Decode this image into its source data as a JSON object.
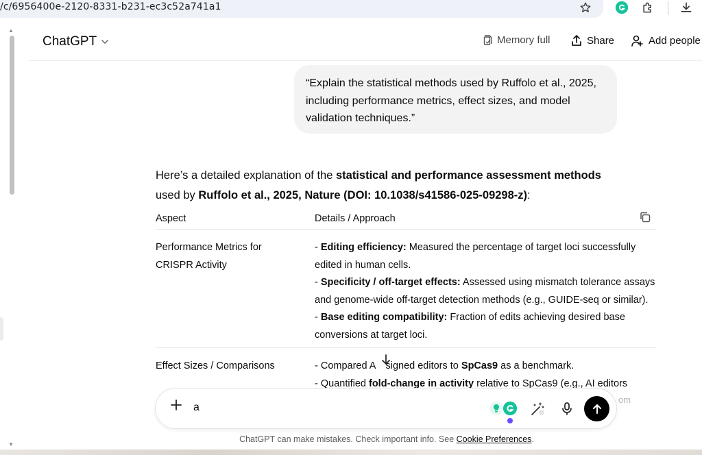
{
  "browser": {
    "url": "/c/6956400e-2120-8331-b231-ec3c52a741a1",
    "icons": [
      "star-icon",
      "grammarly-icon",
      "extensions-icon",
      "download-icon"
    ]
  },
  "header": {
    "model_name": "ChatGPT",
    "memory_label": "Memory full",
    "share_label": "Share",
    "add_people_label": "Add people"
  },
  "user_message": "“Explain the statistical methods used by Ruffolo et al., 2025, including performance metrics, effect sizes, and model validation techniques.”",
  "answer": {
    "intro_1": "Here’s a detailed explanation of the ",
    "intro_bold_1": "statistical and performance assessment methods",
    "intro_2": "used by ",
    "intro_bold_2": "Ruffolo et al., 2025, Nature (DOI: 10.1038/s41586-025-09298-z)",
    "intro_3": ":"
  },
  "table": {
    "headers": [
      "Aspect",
      "Details / Approach"
    ],
    "rows": [
      {
        "aspect": "Performance Metrics for CRISPR Activity",
        "items": [
          {
            "bold": "Editing efficiency:",
            "text": " Measured the percentage of target loci successfully edited in human cells."
          },
          {
            "bold": "Specificity / off-target effects:",
            "text": " Assessed using mismatch tolerance assays and genome-wide off-target detection methods (e.g., GUIDE-seq or similar)."
          },
          {
            "bold": "Base editing compatibility:",
            "text": " Fraction of edits achieving desired base conversions at target loci."
          }
        ]
      },
      {
        "aspect": "Effect Sizes / Comparisons",
        "line1_a": "- Compared A",
        "line1_b": "signed editors to ",
        "line1_bold": "SpCas9",
        "line1_c": " as a benchmark.",
        "line2_a": "- Quantified ",
        "line2_bold": "fold-change in activity",
        "line2_b": " relative to SpCas9 (e.g., AI editors"
      }
    ]
  },
  "composer": {
    "value": "a",
    "overflow_fragment": "om"
  },
  "footer": {
    "disclaimer": "ChatGPT can make mistakes. Check important info. See ",
    "link": "Cookie Preferences",
    "end": "."
  },
  "colors": {
    "send_button": "#000000",
    "grammarly_green": "#15c39a",
    "url_bar_bg": "#eef1f8"
  }
}
